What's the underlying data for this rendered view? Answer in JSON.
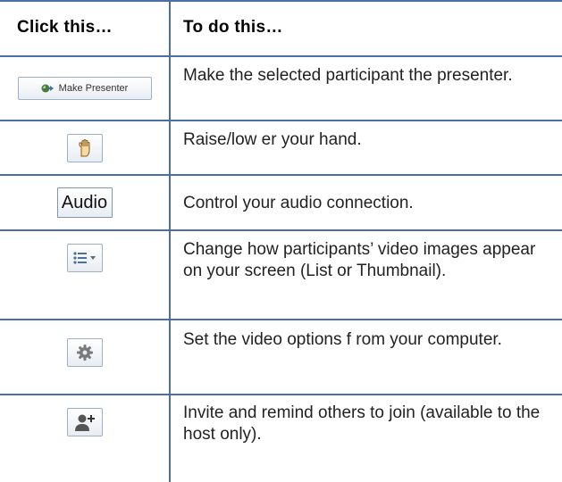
{
  "table": {
    "headers": {
      "col1": "Click this…",
      "col2": "To do this…"
    },
    "rows": [
      {
        "button_label": "Make Presenter",
        "icon": "presenter-icon",
        "description": "Make the selected participant the presenter."
      },
      {
        "button_label": "",
        "icon": "raise-hand-icon",
        "description": "Raise/low er your hand."
      },
      {
        "button_label": "Audio",
        "icon": "",
        "description": "Control your audio connection."
      },
      {
        "button_label": "",
        "icon": "list-view-icon",
        "description": "Change how participants’ video images appear on your screen (List or Thumbnail)."
      },
      {
        "button_label": "",
        "icon": "gear-icon",
        "description": "Set the video options f rom your computer."
      },
      {
        "button_label": "",
        "icon": "add-user-icon",
        "description": "Invite and remind others to join (available to the host only)."
      }
    ]
  }
}
